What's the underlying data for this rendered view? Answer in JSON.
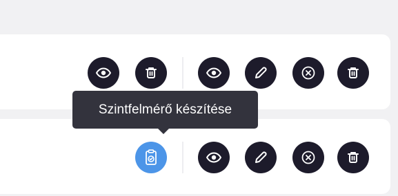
{
  "tooltip": {
    "text": "Szintfelmérő készítése"
  },
  "rows": [
    {
      "actions_left": [
        "eye-icon",
        "trash-icon"
      ],
      "actions_right": [
        "eye-icon",
        "pencil-icon",
        "close-circle-icon",
        "trash-icon"
      ]
    },
    {
      "actions_left": [
        "clipboard-check-icon"
      ],
      "actions_right": [
        "eye-icon",
        "pencil-icon",
        "close-circle-icon",
        "trash-icon"
      ]
    }
  ],
  "colors": {
    "page_background": "#f1f1f3",
    "card_background": "#ffffff",
    "button_dark": "#1d1b2b",
    "button_active_blue": "#4c95e8",
    "tooltip_background": "#33333d",
    "tooltip_text": "#ffffff"
  }
}
